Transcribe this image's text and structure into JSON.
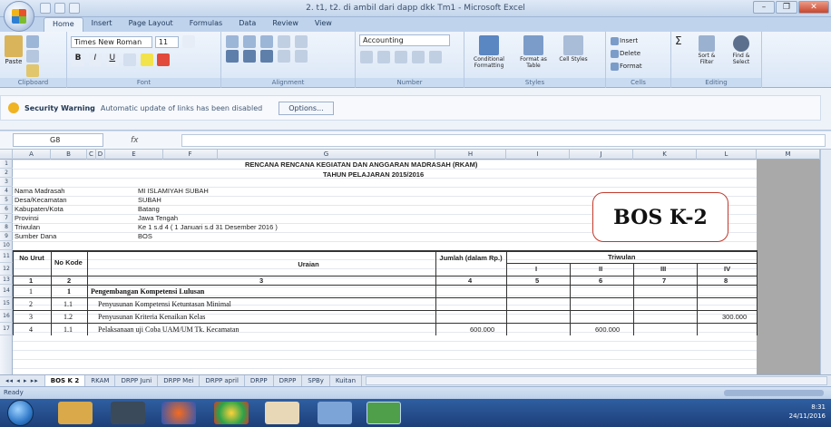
{
  "window": {
    "title": "2. t1, t2. di ambil dari dapp dkk Tm1 - Microsoft Excel",
    "controls": [
      "–",
      "❐",
      "✕"
    ]
  },
  "ribbon": {
    "tabs": [
      "Home",
      "Insert",
      "Page Layout",
      "Formulas",
      "Data",
      "Review",
      "View"
    ],
    "active_tab": "Home",
    "font_name": "Times New Roman",
    "font_size": "11",
    "number_format": "Accounting",
    "buttons": {
      "paste": "Paste",
      "conditional": "Conditional Formatting",
      "format_table": "Format as Table",
      "cell_styles": "Cell Styles",
      "insert": "Insert",
      "delete": "Delete",
      "format": "Format",
      "sort": "Sort & Filter",
      "find": "Find & Select"
    },
    "groups": [
      "Clipboard",
      "Font",
      "Alignment",
      "Number",
      "Styles",
      "Cells",
      "Editing"
    ]
  },
  "security": {
    "title": "Security Warning",
    "text": "Automatic update of links has been disabled",
    "options_button": "Options..."
  },
  "formula_bar": {
    "name_box": "G8",
    "fx": "fx",
    "content": ""
  },
  "columns": [
    "A",
    "B",
    "C",
    "D",
    "E",
    "F",
    "G",
    "H",
    "I",
    "J",
    "K",
    "L",
    "M"
  ],
  "rows": [
    "1",
    "2",
    "3",
    "4",
    "5",
    "6",
    "7",
    "8",
    "9",
    "10",
    "11",
    "12",
    "13",
    "14",
    "15",
    "16",
    "17"
  ],
  "sheet": {
    "heading1": "RENCANA RENCANA KEGIATAN DAN ANGGARAN MADRASAH (RKAM)",
    "heading2": "TAHUN PELAJARAN 2015/2016",
    "info": [
      {
        "label": "Nama Madrasah",
        "value": "MI ISLAMIYAH SUBAH"
      },
      {
        "label": "Desa/Kecamatan",
        "value": "SUBAH"
      },
      {
        "label": "Kabupaten/Kota",
        "value": "Batang"
      },
      {
        "label": "Provinsi",
        "value": "Jawa Tengah"
      },
      {
        "label": "Triwulan",
        "value": "Ke 1 s.d 4 ( 1 Januari s.d 31 Desember 2016 )"
      },
      {
        "label": "Sumber Dana",
        "value": "BOS"
      }
    ],
    "table_headers": {
      "no_urut": "No Urut",
      "no_kode": "No Kode",
      "uraian": "Uraian",
      "jumlah": "Jumlah (dalam Rp.)",
      "triwulan": "Triwulan",
      "tw": [
        "I",
        "II",
        "III",
        "IV"
      ]
    },
    "col_numbers": [
      "1",
      "2",
      "3",
      "4",
      "5",
      "6",
      "7",
      "8"
    ],
    "rows": [
      {
        "no": "1",
        "kode": "1",
        "uraian": "Pengembangan Kompetensi Lulusan",
        "bold": true,
        "jumlah": "",
        "tw1": "",
        "tw2": "",
        "tw3": "",
        "tw4": ""
      },
      {
        "no": "2",
        "kode": "1.1",
        "uraian": "Penyusunan Kompetensi Ketuntasan Minimal",
        "bold": false,
        "jumlah": "",
        "tw1": "",
        "tw2": "",
        "tw3": "",
        "tw4": ""
      },
      {
        "no": "3",
        "kode": "1.2",
        "uraian": "Penyusunan Kriteria Kenaikan Kelas",
        "bold": false,
        "jumlah": "",
        "tw1": "",
        "tw2": "",
        "tw3": "",
        "tw4": "300.000"
      },
      {
        "no": "4",
        "kode": "1.1",
        "uraian": "Pelaksanaan uji Coba UAM/UM Tk. Kecamatan",
        "bold": false,
        "jumlah": "600.000",
        "tw1": "",
        "tw2": "600.000",
        "tw3": "",
        "tw4": ""
      }
    ],
    "bos_label": "BOS K-2"
  },
  "sheet_tabs": [
    "BOS K 2",
    "RKAM",
    "DRPP Juni",
    "DRPP Mei",
    "DRPP april",
    "DRPP",
    "DRPP",
    "SPBy",
    "Kuitan"
  ],
  "active_sheet": "BOS K 2",
  "status": "Ready",
  "tray": {
    "time": "8:31",
    "date": "24/11/2016"
  }
}
